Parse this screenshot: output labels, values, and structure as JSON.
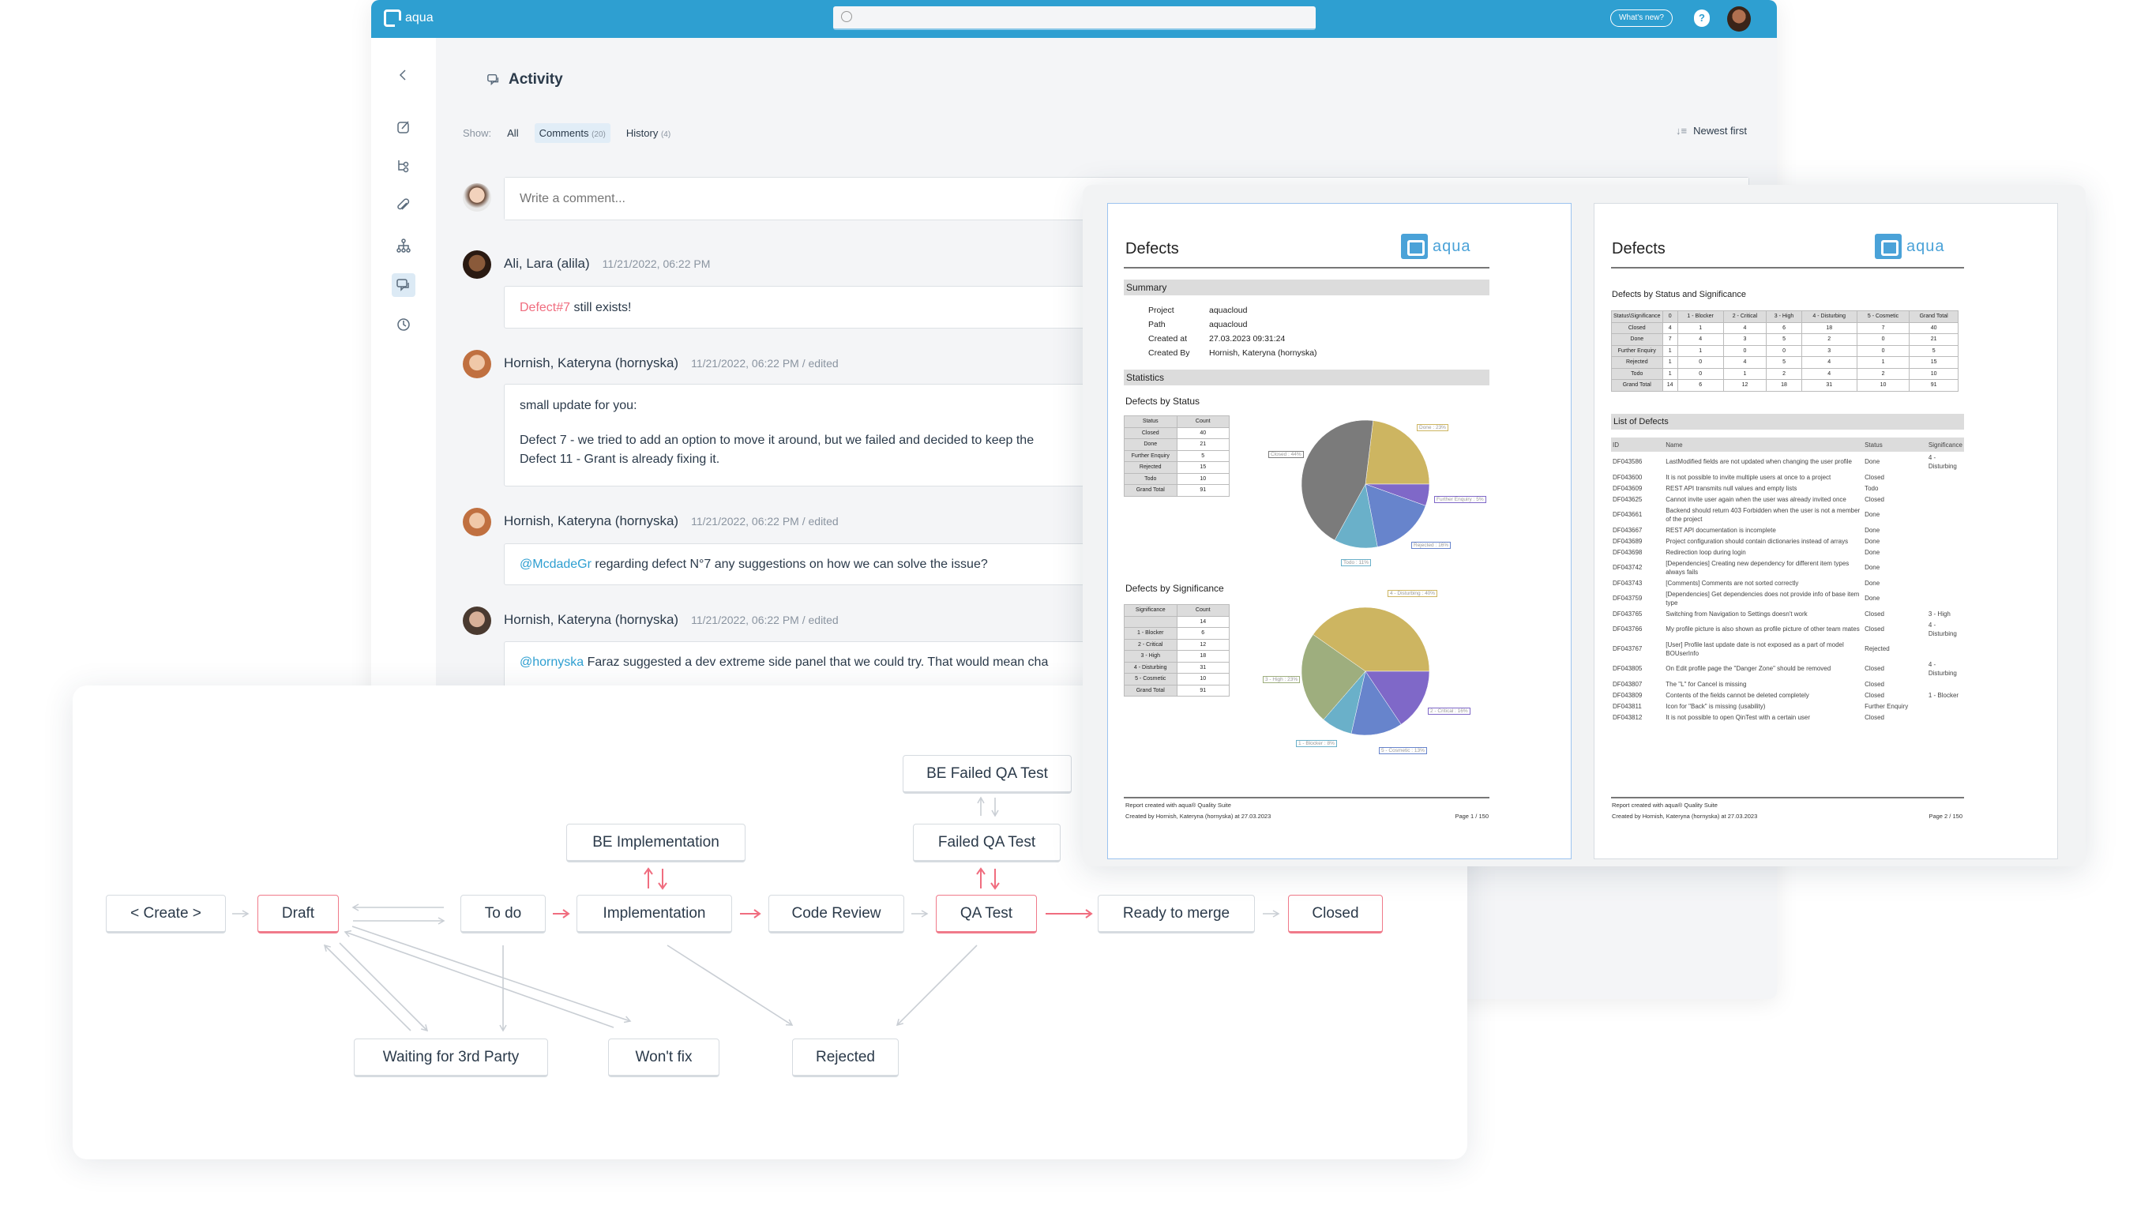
{
  "topbar": {
    "logo_text": "aqua",
    "search_placeholder": "",
    "whats_new": "What's new?",
    "help": "?"
  },
  "sidebar": {
    "items": [
      "back-chevron-icon",
      "edit-icon",
      "tree-icon",
      "attachment-icon",
      "hierarchy-icon",
      "comments-icon",
      "history-clock-icon"
    ],
    "active": "comments-icon"
  },
  "activity": {
    "title": "Activity",
    "show_label": "Show:",
    "filters": [
      {
        "label": "All",
        "count": ""
      },
      {
        "label": "Comments",
        "count": "(20)"
      },
      {
        "label": "History",
        "count": "(4)"
      }
    ],
    "active_filter": "Comments",
    "sort_label": "Newest first",
    "comment_placeholder": "Write a comment...",
    "comments": [
      {
        "author": "Ali, Lara (alila)",
        "timestamp": "11/21/2022, 06:22 PM",
        "mention": "Defect#7",
        "text": " still exists!"
      },
      {
        "author": "Hornish, Kateryna (hornyska)",
        "timestamp": "11/21/2022, 06:22 PM / edited",
        "lines": [
          "small update for you:",
          "Defect 7 - we tried to add an option to move it around, but we failed and decided to keep the",
          "Defect 11 - Grant is already fixing it."
        ]
      },
      {
        "author": "Hornish, Kateryna (hornyska)",
        "timestamp": "11/21/2022, 06:22 PM / edited",
        "mention": "@McdadeGr",
        "text": " regarding defect N°7 any suggestions on how we can solve the issue?"
      },
      {
        "author": "Hornish, Kateryna (hornyska)",
        "timestamp": "11/21/2022, 06:22 PM / edited",
        "mention": "@hornyska",
        "text": " Faraz suggested a dev extreme side panel that we could try. That would mean cha"
      }
    ]
  },
  "workflow": {
    "nodes": {
      "create": "< Create >",
      "draft": "Draft",
      "todo": "To do",
      "implementation": "Implementation",
      "code_review": "Code Review",
      "qa_test": "QA Test",
      "ready_to_merge": "Ready to merge",
      "closed": "Closed",
      "be_implementation": "BE Implementation",
      "failed_qa_test": "Failed QA Test",
      "be_failed_qa_test": "BE Failed QA Test",
      "waiting": "Waiting for 3rd Party",
      "wont_fix": "Won't fix",
      "rejected": "Rejected"
    },
    "highlighted": [
      "draft",
      "qa_test",
      "closed"
    ],
    "accent_color": "#f06d7f"
  },
  "reports": {
    "page1": {
      "title": "Defects",
      "logo_text": "aqua",
      "summary_heading": "Summary",
      "summary": [
        {
          "label": "Project",
          "value": "aquacloud"
        },
        {
          "label": "Path",
          "value": "aquacloud"
        },
        {
          "label": "Created at",
          "value": "27.03.2023 09:31:24"
        },
        {
          "label": "Created By",
          "value": "Hornish, Kateryna (hornyska)"
        }
      ],
      "statistics_heading": "Statistics",
      "status_title": "Defects by Status",
      "status_table": {
        "headers": [
          "Status",
          "Count"
        ],
        "rows": [
          [
            "Closed",
            "40"
          ],
          [
            "Done",
            "21"
          ],
          [
            "Further Enquiry",
            "5"
          ],
          [
            "Rejected",
            "15"
          ],
          [
            "Todo",
            "10"
          ],
          [
            "Grand Total",
            "91"
          ]
        ]
      },
      "significance_title": "Defects by Significance",
      "significance_table": {
        "headers": [
          "Significance",
          "Count"
        ],
        "rows": [
          [
            "",
            "14"
          ],
          [
            "1 - Blocker",
            "6"
          ],
          [
            "2 - Critical",
            "12"
          ],
          [
            "3 - High",
            "18"
          ],
          [
            "4 - Disturbing",
            "31"
          ],
          [
            "5 - Cosmetic",
            "10"
          ],
          [
            "Grand Total",
            "91"
          ]
        ]
      },
      "footer_line1": "Report created with aqua® Quality Suite",
      "footer_line2": "Created by Hornish, Kateryna (hornyska) at 27.03.2023",
      "page_label": "Page 1 / 150"
    },
    "page2": {
      "title": "Defects",
      "logo_text": "aqua",
      "matrix_title": "Defects by Status and Significance",
      "matrix": {
        "headers": [
          "Status\\Significance",
          "0",
          "1 - Blocker",
          "2 - Critical",
          "3 - High",
          "4 - Disturbing",
          "5 - Cosmetic",
          "Grand Total"
        ],
        "rows": [
          [
            "Closed",
            "4",
            "1",
            "4",
            "6",
            "18",
            "7",
            "40"
          ],
          [
            "Done",
            "7",
            "4",
            "3",
            "5",
            "2",
            "0",
            "21"
          ],
          [
            "Further Enquiry",
            "1",
            "1",
            "0",
            "0",
            "3",
            "0",
            "5"
          ],
          [
            "Rejected",
            "1",
            "0",
            "4",
            "5",
            "4",
            "1",
            "15"
          ],
          [
            "Todo",
            "1",
            "0",
            "1",
            "2",
            "4",
            "2",
            "10"
          ],
          [
            "Grand Total",
            "14",
            "6",
            "12",
            "18",
            "31",
            "10",
            "91"
          ]
        ]
      },
      "list_heading": "List of Defects",
      "list_headers": [
        "ID",
        "Name",
        "Status",
        "Significance"
      ],
      "defects": [
        [
          "DF043586",
          "LastModified fields are not updated when changing the user profile",
          "Done",
          "4 - Disturbing"
        ],
        [
          "DF043600",
          "It is not possible to invite multiple users at once to a project",
          "Closed",
          ""
        ],
        [
          "DF043609",
          "REST API transmits null values and empty lists",
          "Todo",
          ""
        ],
        [
          "DF043625",
          "Cannot invite user again when the user was already invited once",
          "Closed",
          ""
        ],
        [
          "DF043661",
          "Backend should return 403 Forbidden when the user is not a member of the project",
          "Done",
          ""
        ],
        [
          "DF043667",
          "REST API documentation is incomplete",
          "Done",
          ""
        ],
        [
          "DF043689",
          "Project configuration should contain dictionaries instead of arrays",
          "Done",
          ""
        ],
        [
          "DF043698",
          "Redirection loop during login",
          "Done",
          ""
        ],
        [
          "DF043742",
          "[Dependencies] Creating new dependency for different item types always fails",
          "Done",
          ""
        ],
        [
          "DF043743",
          "[Comments] Comments are not sorted correctly",
          "Done",
          ""
        ],
        [
          "DF043759",
          "[Dependencies] Get dependencies does not provide info of base item type",
          "Done",
          ""
        ],
        [
          "DF043765",
          "Switching from Navigation to Settings doesn't work",
          "Closed",
          "3 - High"
        ],
        [
          "DF043766",
          "My profile picture is also shown as profile picture of other team mates",
          "Closed",
          "4 - Disturbing"
        ],
        [
          "DF043767",
          "[User] Profile last update date is not exposed as a part of model BOUserInfo",
          "Rejected",
          ""
        ],
        [
          "DF043805",
          "On Edit profile page the \"Danger Zone\" should be removed",
          "Closed",
          "4 - Disturbing"
        ],
        [
          "DF043807",
          "The \"L\" for Cancel is missing",
          "Closed",
          ""
        ],
        [
          "DF043809",
          "Contents of the fields cannot be deleted completely",
          "Closed",
          "1 - Blocker"
        ],
        [
          "DF043811",
          "Icon for \"Back\" is missing (usability)",
          "Further Enquiry",
          ""
        ],
        [
          "DF043812",
          "It is not possible to open QinTest with a certain user",
          "Closed",
          ""
        ]
      ],
      "footer_line1": "Report created with aqua® Quality Suite",
      "footer_line2": "Created by Hornish, Kateryna (hornyska) at 27.03.2023",
      "page_label": "Page 2 / 150"
    }
  },
  "chart_data": [
    {
      "type": "pie",
      "title": "Defects by Status",
      "slices": [
        {
          "label": "Done : 23%",
          "category": "Done",
          "value": 21,
          "color": "#cdb561"
        },
        {
          "label": "Further Enquiry : 5%",
          "category": "Further Enquiry",
          "value": 5,
          "color": "#7f68c8"
        },
        {
          "label": "Rejected : 16%",
          "category": "Rejected",
          "value": 15,
          "color": "#6784cc"
        },
        {
          "label": "Todo : 11%",
          "category": "Todo",
          "value": 10,
          "color": "#6ab0c9"
        },
        {
          "label": "Closed : 44%",
          "category": "Closed",
          "value": 40,
          "color": "#7b7b7b"
        }
      ]
    },
    {
      "type": "pie",
      "title": "Defects by Significance",
      "slices": [
        {
          "label": "4 - Disturbing : 40%",
          "category": "4 - Disturbing",
          "value": 31,
          "color": "#cdb561"
        },
        {
          "label": "2 - Critical : 16%",
          "category": "2 - Critical",
          "value": 12,
          "color": "#7f68c8"
        },
        {
          "label": "5 - Cosmetic : 13%",
          "category": "5 - Cosmetic",
          "value": 10,
          "color": "#6784cc"
        },
        {
          "label": "1 - Blocker : 8%",
          "category": "1 - Blocker",
          "value": 6,
          "color": "#6ab0c9"
        },
        {
          "label": "3 - High : 23%",
          "category": "3 - High",
          "value": 18,
          "color": "#9eae7e"
        }
      ]
    }
  ]
}
